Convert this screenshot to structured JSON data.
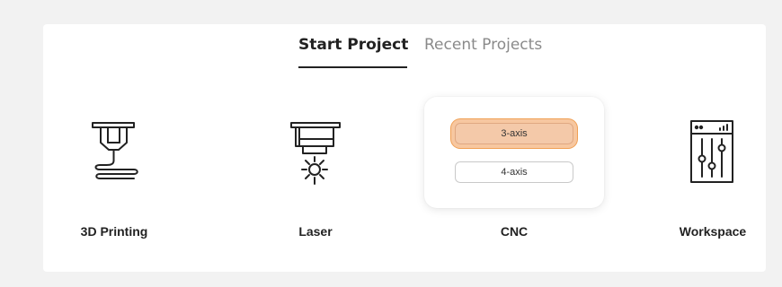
{
  "tabs": {
    "start_project": "Start Project",
    "recent_projects": "Recent Projects"
  },
  "tiles": [
    {
      "label": "3D Printing",
      "icon": "3d-printer-nozzle-icon"
    },
    {
      "label": "Laser",
      "icon": "laser-head-icon"
    },
    {
      "label": "CNC",
      "icon": "cnc-icon"
    },
    {
      "label": "Workspace",
      "icon": "workspace-sliders-icon"
    }
  ],
  "cnc_options": {
    "axis3": "3-axis",
    "axis4": "4-axis",
    "selected": "3-axis"
  },
  "colors": {
    "background": "#f2f2f2",
    "card": "#ffffff",
    "text": "#222222",
    "muted_tab": "#8a8a8a",
    "highlight": "#f4c9a9",
    "highlight_border": "#f0a055"
  }
}
